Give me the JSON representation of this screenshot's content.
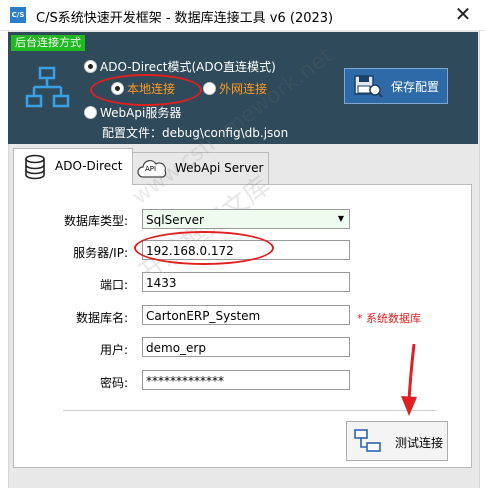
{
  "window": {
    "title": "C/S系统快速开发框架 - 数据库连接工具 v6 (2023)",
    "app_icon_text": "C/S"
  },
  "connection_mode": {
    "section_label": "后台连接方式",
    "ado_label": "ADO-Direct模式(ADO直连模式)",
    "local_label": "本地连接",
    "external_label": "外网连接",
    "webapi_label": "WebApi服务器",
    "config_file": "配置文件：debug\\config\\db.json",
    "save_label": "保存配置"
  },
  "tabs": [
    {
      "label": "ADO-Direct",
      "active": true
    },
    {
      "label": "WebApi Server",
      "api_badge": "API",
      "active": false
    }
  ],
  "form": {
    "db_type_label": "数据库类型:",
    "db_type_value": "SqlServer",
    "server_label": "服务器/IP:",
    "server_value": "192.168.0.172",
    "port_label": "端口:",
    "port_value": "1433",
    "dbname_label": "数据库名:",
    "dbname_value": "CartonERP_System",
    "dbname_note": "* 系统数据库",
    "user_label": "用户:",
    "user_value": "demo_erp",
    "password_label": "密码:",
    "password_value": "*************",
    "test_label": "测试连接"
  },
  "watermark": {
    "line1": "www.csframework.net",
    "line2": "开发框架文库"
  },
  "colors": {
    "panel": "#2f4a5a",
    "green": "#1fba1f",
    "orange": "#ff9a1e",
    "red": "#e02020",
    "save": "#2f6aa8"
  }
}
